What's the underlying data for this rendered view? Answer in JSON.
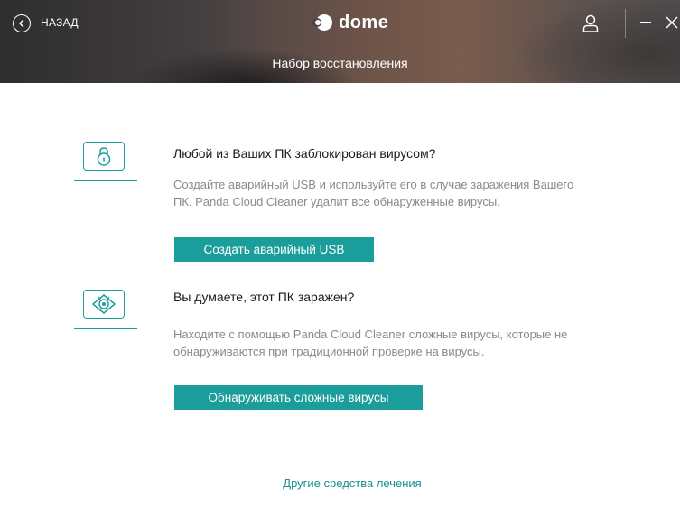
{
  "header": {
    "back_label": "НАЗАД",
    "logo_text": "dome",
    "subtitle": "Набор восстановления"
  },
  "sections": [
    {
      "icon": "lock-icon",
      "title": "Любой из Ваших ПК заблокирован вирусом?",
      "description_lines": [
        "Создайте аварийный USB и используйте его в случае заражения Вашего",
        "ПК. Panda Cloud Cleaner удалит все обнаруженные вирусы."
      ],
      "button_label": "Создать аварийный USB"
    },
    {
      "icon": "virus-eye-icon",
      "title": "Вы думаете, этот ПК заражен?",
      "description_lines": [
        "Находите с помощью Panda Cloud Cleaner сложные вирусы, которые не",
        "обнаруживаются при традиционной проверке на вирусы."
      ],
      "button_label": "Обнаруживать сложные вирусы"
    }
  ],
  "footer": {
    "other_tools_link": "Другие средства лечения"
  },
  "colors": {
    "accent": "#1b9e9b",
    "link": "#1a8f8f",
    "text": "#1a1a1a",
    "muted_text": "#8a8a8a"
  }
}
